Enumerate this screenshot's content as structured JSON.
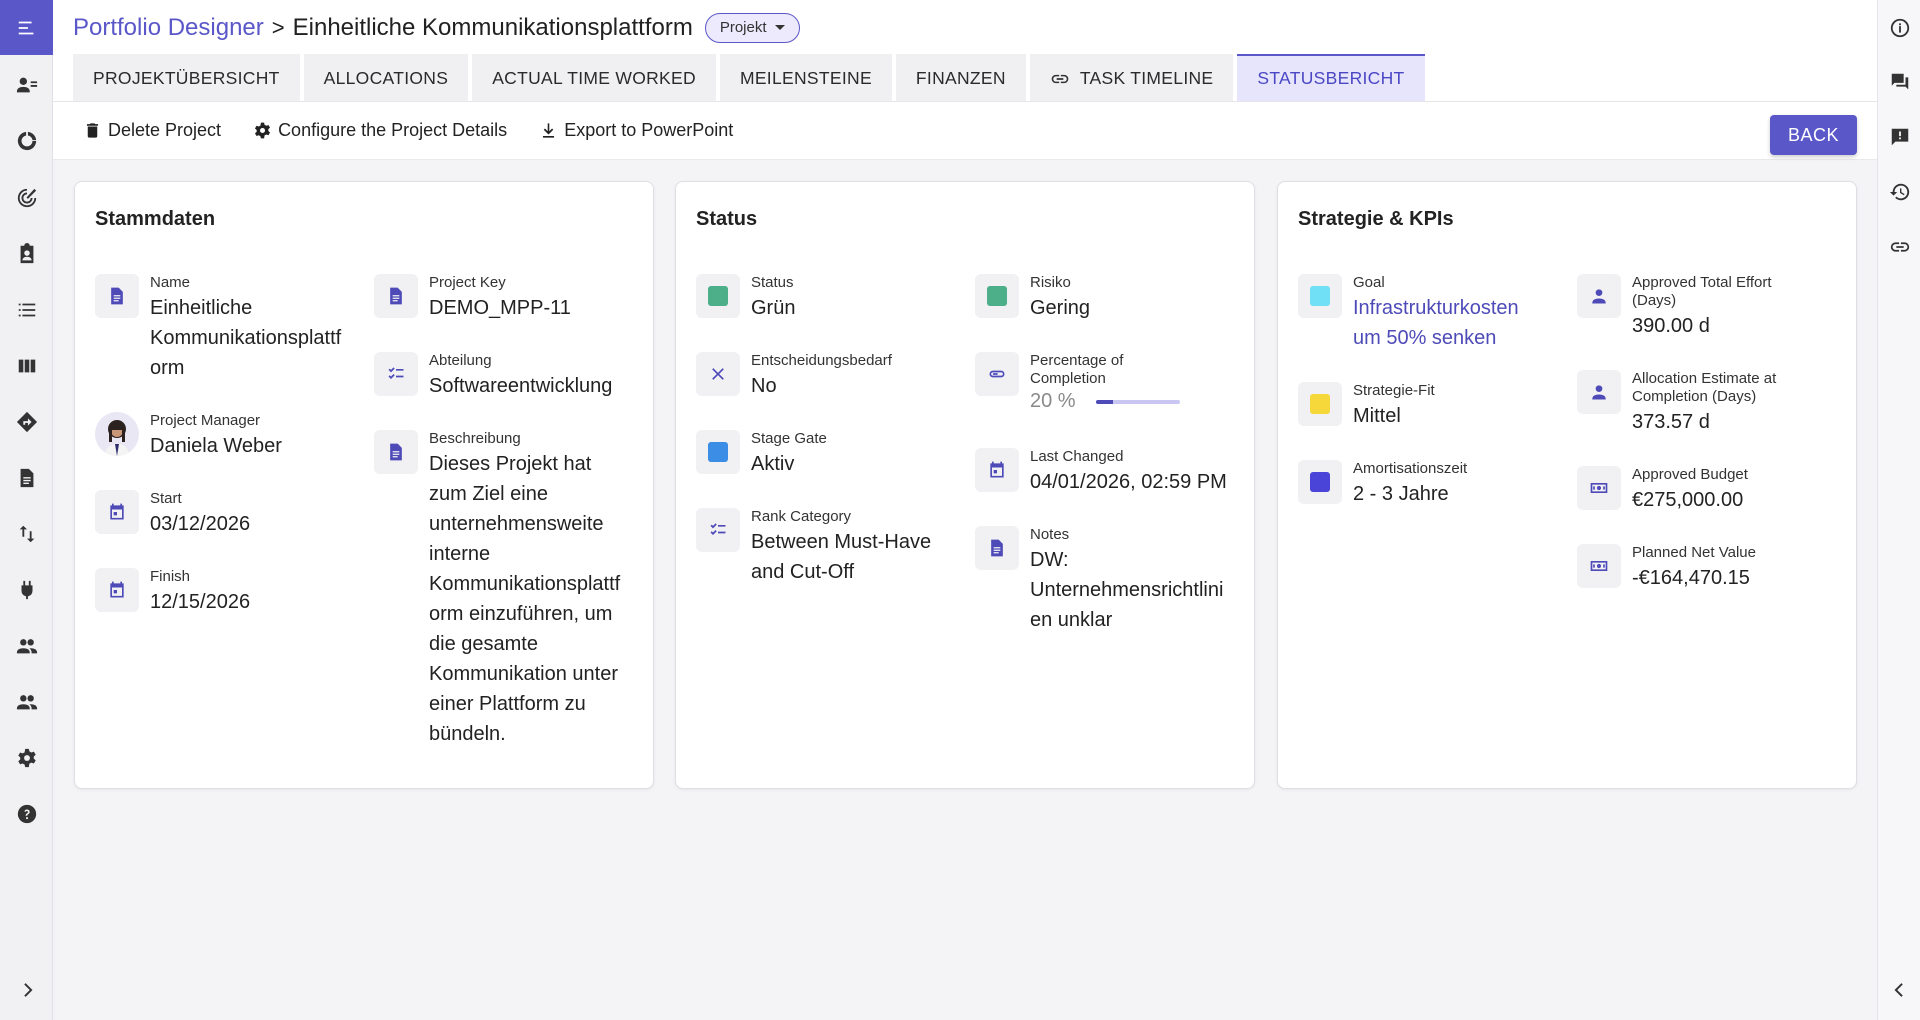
{
  "header": {
    "app_name": "Portfolio Designer",
    "separator": ">",
    "project_title": "Einheitliche Kommunikationsplattform",
    "type_chip": "Projekt"
  },
  "tabs": [
    {
      "label": "PROJEKTÜBERSICHT",
      "active": false
    },
    {
      "label": "ALLOCATIONS",
      "active": false
    },
    {
      "label": "ACTUAL TIME WORKED",
      "active": false
    },
    {
      "label": "MEILENSTEINE",
      "active": false
    },
    {
      "label": "FINANZEN",
      "active": false
    },
    {
      "label": "TASK TIMELINE",
      "active": false,
      "icon": "link-icon"
    },
    {
      "label": "STATUSBERICHT",
      "active": true
    }
  ],
  "toolbar": {
    "delete_label": "Delete Project",
    "configure_label": "Configure the Project Details",
    "export_label": "Export to PowerPoint",
    "back_label": "BACK"
  },
  "stammdaten": {
    "title": "Stammdaten",
    "name_label": "Name",
    "name_value_1": "Einheitliche",
    "name_value_2": "Kommunikationsplattf",
    "name_value_3": "orm",
    "manager_label": "Project Manager",
    "manager_value": "Daniela Weber",
    "start_label": "Start",
    "start_value": "03/12/2026",
    "finish_label": "Finish",
    "finish_value": "12/15/2026",
    "key_label": "Project Key",
    "key_value": "DEMO_MPP-11",
    "department_label": "Abteilung",
    "department_value": "Softwareentwicklung",
    "description_label": "Beschreibung",
    "description_lines": [
      "Dieses Projekt hat",
      "zum Ziel eine",
      "unternehmensweite",
      "interne",
      "Kommunikationsplattf",
      "orm einzuführen, um",
      "die gesamte",
      "Kommunikation unter",
      "einer Plattform zu",
      "bündeln."
    ]
  },
  "status": {
    "title": "Status",
    "status_label": "Status",
    "status_value": "Grün",
    "status_color": "#4caf8a",
    "decision_label": "Entscheidungsbedarf",
    "decision_value": "No",
    "stage_label": "Stage Gate",
    "stage_value": "Aktiv",
    "stage_color": "#3b8de6",
    "rank_label": "Rank Category",
    "rank_value_1": "Between Must-Have",
    "rank_value_2": "and Cut-Off",
    "risk_label": "Risiko",
    "risk_value": "Gering",
    "risk_color": "#4caf8a",
    "completion_label_1": "Percentage of",
    "completion_label_2": "Completion",
    "completion_text": "20 %",
    "completion_fraction": 0.2,
    "changed_label": "Last Changed",
    "changed_value": "04/01/2026, 02:59 PM",
    "notes_label": "Notes",
    "notes_value_1": "DW:",
    "notes_value_2": "Unternehmensrichtlini",
    "notes_value_3": "en unklar"
  },
  "strategy": {
    "title": "Strategie & KPIs",
    "goal_label": "Goal",
    "goal_value_1": "Infrastrukturkosten",
    "goal_value_2": "um 50% senken",
    "goal_color": "#6fe0f5",
    "fit_label": "Strategie-Fit",
    "fit_value": "Mittel",
    "fit_color": "#f7d83a",
    "amort_label": "Amortisationszeit",
    "amort_value": "2 - 3 Jahre",
    "amort_color": "#4a45d8",
    "effort_label_1": "Approved Total Effort",
    "effort_label_2": "(Days)",
    "effort_value": "390.00 d",
    "estimate_label_1": "Allocation Estimate at",
    "estimate_label_2": "Completion (Days)",
    "estimate_value": "373.57 d",
    "budget_label": "Approved Budget",
    "budget_value": "€275,000.00",
    "npv_label": "Planned Net Value",
    "npv_value": "-€164,470.15"
  }
}
